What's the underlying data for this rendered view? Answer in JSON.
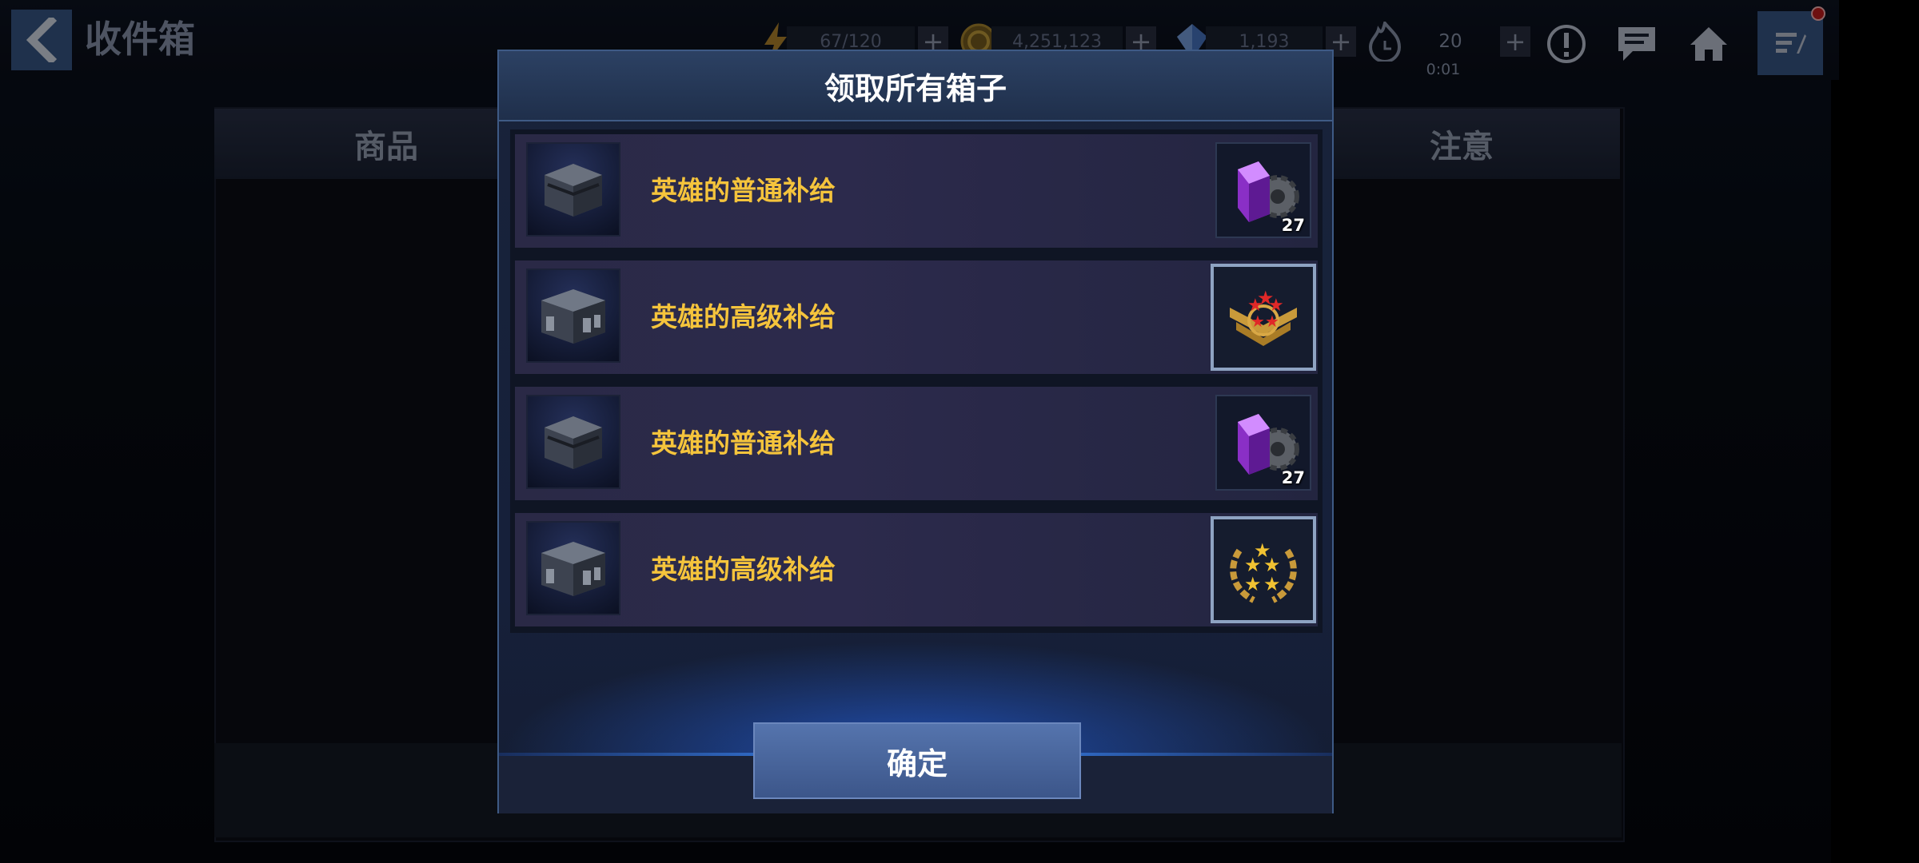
{
  "header": {
    "title": "收件箱",
    "resources": {
      "energy": "67/120",
      "gold": "4,251,123",
      "crystal": "1,193",
      "stamina": "20",
      "stamina_timer": "0:01"
    },
    "plus_label": "+"
  },
  "background": {
    "column_left": "商品",
    "column_right": "注意"
  },
  "dialog": {
    "title": "领取所有箱子",
    "items": [
      {
        "label": "英雄的普通补给",
        "reward_icon": "purple-gear-cube",
        "reward_count": "27"
      },
      {
        "label": "英雄的高级补给",
        "reward_icon": "rank-badge-red-stars",
        "reward_count": ""
      },
      {
        "label": "英雄的普通补给",
        "reward_icon": "purple-gear-cube",
        "reward_count": "27"
      },
      {
        "label": "英雄的高级补给",
        "reward_icon": "laurel-five-stars",
        "reward_count": ""
      }
    ],
    "confirm_label": "确定"
  },
  "colors": {
    "item_label": "#f5c43c",
    "accent_blue": "#3d8bff",
    "button": "#4a66a0"
  }
}
